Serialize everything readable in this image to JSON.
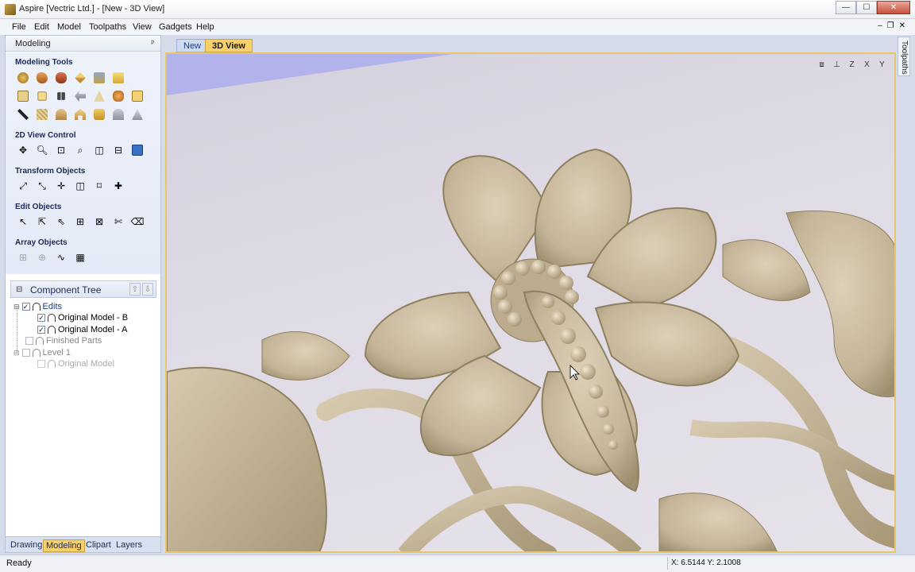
{
  "window": {
    "title": "Aspire [Vectric Ltd.] - [New - 3D View]",
    "min": "—",
    "max": "☐",
    "close": "✕"
  },
  "menu": {
    "items": [
      "File",
      "Edit",
      "Model",
      "Toolpaths",
      "View",
      "Gadgets",
      "Help"
    ],
    "mdi_min": "–",
    "mdi_restore": "❐",
    "mdi_close": "✕"
  },
  "left_panel": {
    "header": "Modeling",
    "pin": "ᵖ",
    "sections": {
      "modeling_tools": "Modeling Tools",
      "view_control": "2D View Control",
      "transform": "Transform Objects",
      "edit": "Edit Objects",
      "array": "Array Objects"
    }
  },
  "component_tree": {
    "title": "Component Tree",
    "items": [
      {
        "label": "Edits",
        "checked": "✓"
      },
      {
        "label": "Original Model - B",
        "checked": "✓"
      },
      {
        "label": "Original Model - A",
        "checked": "✓"
      },
      {
        "label": "Finished Parts",
        "checked": ""
      },
      {
        "label": "Level 1",
        "checked": ""
      },
      {
        "label": "Original Model",
        "checked": ""
      }
    ]
  },
  "bottom_tabs": [
    "Drawing",
    "Modeling",
    "Clipart",
    "Layers"
  ],
  "doc_tabs": [
    "New",
    "3D View"
  ],
  "right_dock": "Toolpaths",
  "status": {
    "left": "Ready",
    "coords": "X: 6.5144 Y: 2.1008"
  },
  "colors": {
    "accent": "#f7cf6b",
    "model": "#c8b9a0",
    "background": "#dcd9e3"
  }
}
